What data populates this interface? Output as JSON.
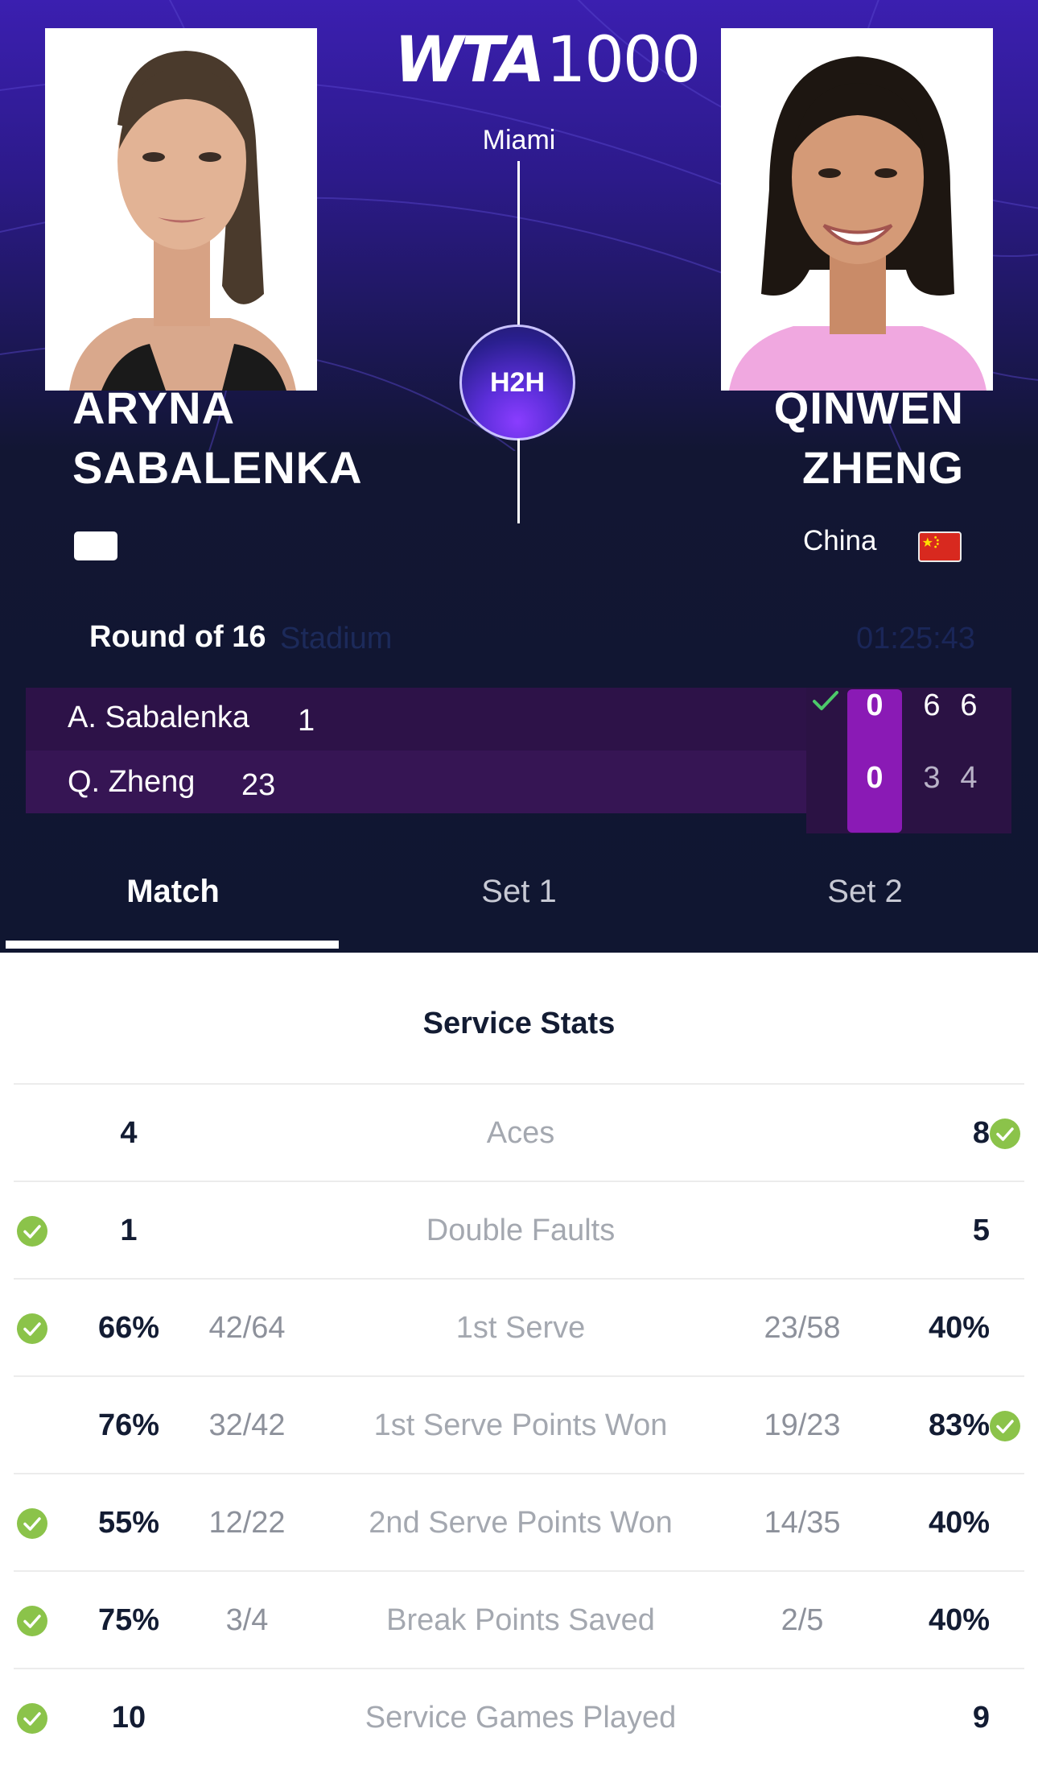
{
  "event": {
    "logo_text": "WTA",
    "logo_level": "1000",
    "city": "Miami",
    "h2h_label": "H2H"
  },
  "players": {
    "left": {
      "name_line1": "ARYNA",
      "name_line2": "SABALENKA",
      "country": ""
    },
    "right": {
      "name_line1": "QINWEN",
      "name_line2": "ZHENG",
      "country": "China"
    }
  },
  "match": {
    "round": "Round of 16",
    "venue": "Stadium",
    "duration": "01:25:43"
  },
  "scoreboard": {
    "rows": [
      {
        "name": "A. Sabalenka",
        "seed": "1",
        "game": "0",
        "sets": [
          "6",
          "6"
        ],
        "winner": true
      },
      {
        "name": "Q. Zheng",
        "seed": "23",
        "game": "0",
        "sets": [
          "3",
          "4"
        ],
        "winner": false
      }
    ]
  },
  "tabs": [
    {
      "label": "Match",
      "active": true
    },
    {
      "label": "Set 1",
      "active": false
    },
    {
      "label": "Set 2",
      "active": false
    }
  ],
  "stats": {
    "title": "Service Stats",
    "rows": [
      {
        "label": "Aces",
        "left_value": "4",
        "left_detail": "",
        "right_value": "8",
        "right_detail": "",
        "leader": "right"
      },
      {
        "label": "Double Faults",
        "left_value": "1",
        "left_detail": "",
        "right_value": "5",
        "right_detail": "",
        "leader": "left"
      },
      {
        "label": "1st Serve",
        "left_value": "66%",
        "left_detail": "42/64",
        "right_value": "40%",
        "right_detail": "23/58",
        "leader": "left"
      },
      {
        "label": "1st Serve Points Won",
        "left_value": "76%",
        "left_detail": "32/42",
        "right_value": "83%",
        "right_detail": "19/23",
        "leader": "right"
      },
      {
        "label": "2nd Serve Points Won",
        "left_value": "55%",
        "left_detail": "12/22",
        "right_value": "40%",
        "right_detail": "14/35",
        "leader": "left"
      },
      {
        "label": "Break Points Saved",
        "left_value": "75%",
        "left_detail": "3/4",
        "right_value": "40%",
        "right_detail": "2/5",
        "leader": "left"
      },
      {
        "label": "Service Games Played",
        "left_value": "10",
        "left_detail": "",
        "right_value": "9",
        "right_detail": "",
        "leader": "left"
      }
    ]
  },
  "colors": {
    "accent_purple": "#8a1ab5",
    "check_green": "#8bc34a",
    "dark_navy": "#101631"
  },
  "icons": {
    "check": "check-circle-icon",
    "winner": "checkmark-icon"
  }
}
